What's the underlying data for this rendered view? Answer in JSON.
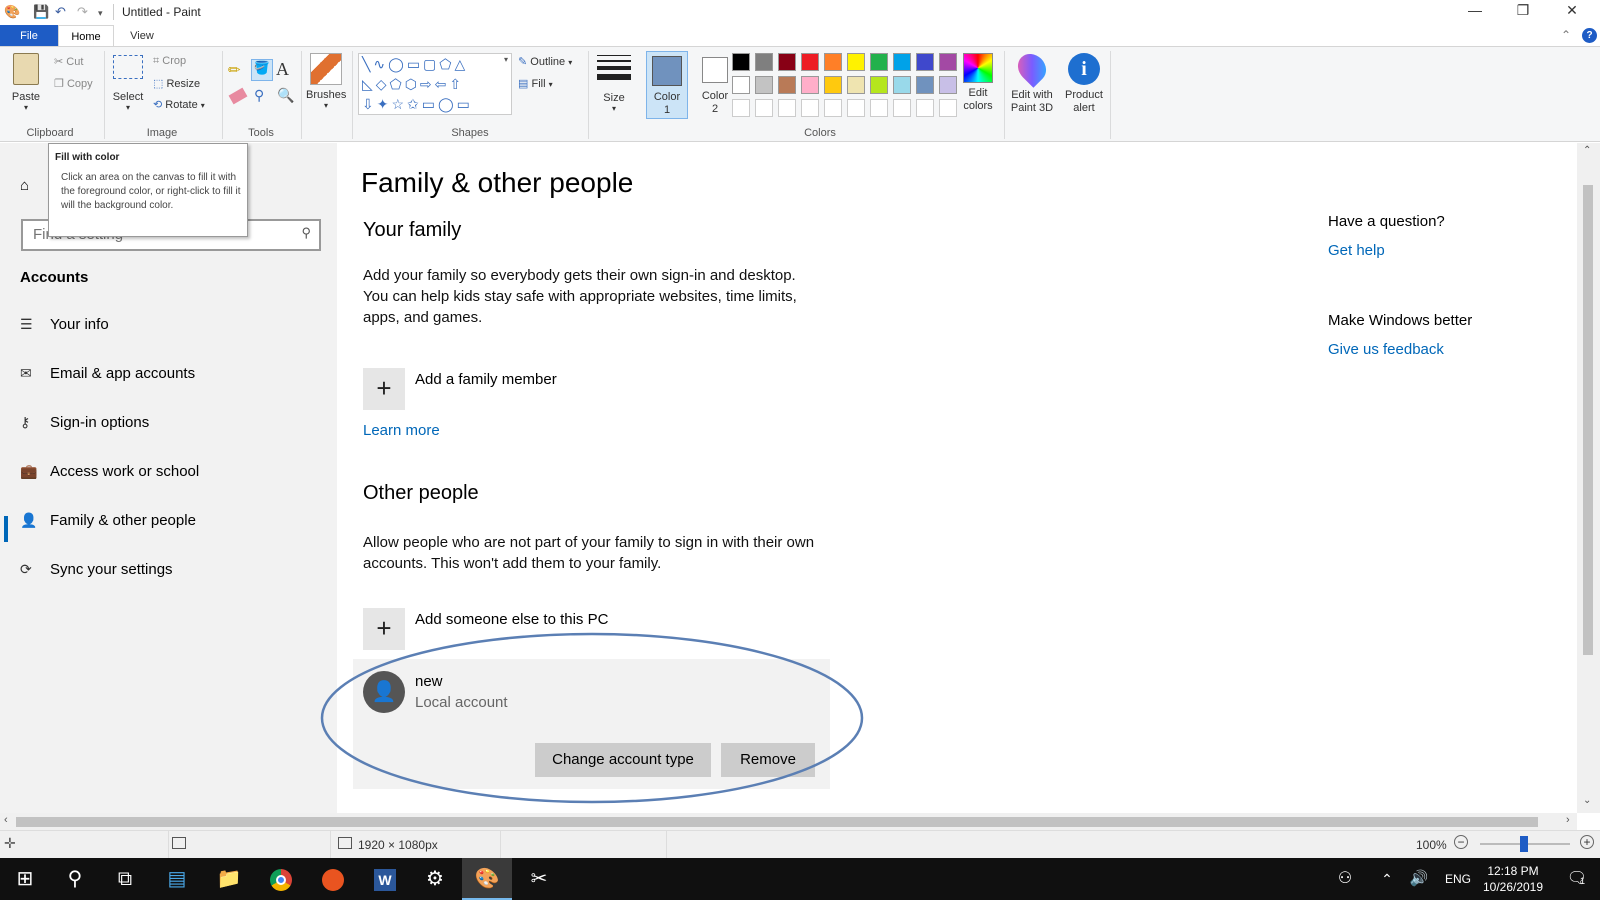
{
  "titlebar": {
    "title": "Untitled - Paint"
  },
  "tabs": {
    "file": "File",
    "home": "Home",
    "view": "View"
  },
  "ribbon": {
    "paste": "Paste",
    "cut": "Cut",
    "copy": "Copy",
    "select": "Select",
    "crop": "Crop",
    "resize": "Resize",
    "rotate": "Rotate",
    "brushes": "Brushes",
    "outline": "Outline",
    "fill": "Fill",
    "size": "Size",
    "color1": "Color 1",
    "color2": "Color 2",
    "edit_colors": "Edit colors",
    "edit_paint3d": "Edit with Paint 3D",
    "product_alert": "Product alert",
    "groups": {
      "clipboard": "Clipboard",
      "image": "Image",
      "tools": "Tools",
      "shapes": "Shapes",
      "colors": "Colors"
    },
    "palette_row1": [
      "#000000",
      "#7f7f7f",
      "#880015",
      "#ed1c24",
      "#ff7f27",
      "#fff200",
      "#22b14c",
      "#00a2e8",
      "#3f48cc",
      "#a349a4"
    ],
    "palette_row2": [
      "#ffffff",
      "#c3c3c3",
      "#b97a57",
      "#ffaec9",
      "#ffc90e",
      "#efe4b0",
      "#b5e61d",
      "#99d9ea",
      "#7092be",
      "#c8bfe7"
    ]
  },
  "tooltip": {
    "title": "Fill with color",
    "body": "Click an area on the canvas to fill it with the foreground color, or right-click to fill it will the background color."
  },
  "sidebar": {
    "search_placeholder": "Find a setting",
    "section": "Accounts",
    "items": [
      {
        "label": "Your info",
        "icon": "person-card-icon"
      },
      {
        "label": "Email & app accounts",
        "icon": "mail-icon"
      },
      {
        "label": "Sign-in options",
        "icon": "key-icon"
      },
      {
        "label": "Access work or school",
        "icon": "briefcase-icon"
      },
      {
        "label": "Family & other people",
        "icon": "person-add-icon"
      },
      {
        "label": "Sync your settings",
        "icon": "sync-icon"
      }
    ]
  },
  "main": {
    "title": "Family & other people",
    "your_family": "Your family",
    "family_desc": "Add your family so everybody gets their own sign-in and desktop. You can help kids stay safe with appropriate websites, time limits, apps, and games.",
    "add_family": "Add a family member",
    "learn_more": "Learn more",
    "other_people": "Other people",
    "other_desc": "Allow people who are not part of your family to sign in with their own accounts. This won't add them to your family.",
    "add_someone": "Add someone else to this PC",
    "account_name": "new",
    "account_type": "Local account",
    "change_type": "Change account type",
    "remove": "Remove"
  },
  "aside": {
    "question": "Have a question?",
    "get_help": "Get help",
    "better": "Make Windows better",
    "feedback": "Give us feedback"
  },
  "status": {
    "dimensions": "1920 × 1080px",
    "zoom": "100%"
  },
  "taskbar": {
    "lang": "ENG",
    "time": "12:18 PM",
    "date": "10/26/2019",
    "notif": "1"
  }
}
